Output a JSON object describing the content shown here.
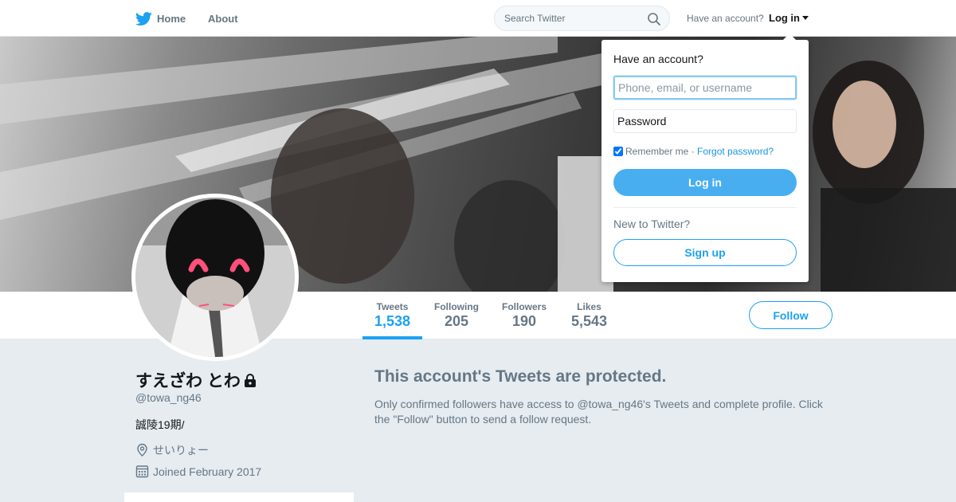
{
  "nav": {
    "home": "Home",
    "about": "About",
    "search_placeholder": "Search Twitter",
    "have_account": "Have an account?",
    "login": "Log in"
  },
  "profile": {
    "name": "すえざわ とわ",
    "handle": "@towa_ng46",
    "bio": "誠陵19期/",
    "location": "せいりょー",
    "joined": "Joined February 2017"
  },
  "stats": [
    {
      "label": "Tweets",
      "value": "1,538"
    },
    {
      "label": "Following",
      "value": "205"
    },
    {
      "label": "Followers",
      "value": "190"
    },
    {
      "label": "Likes",
      "value": "5,543"
    }
  ],
  "follow_button": "Follow",
  "protected": {
    "title": "This account's Tweets are protected.",
    "text": "Only confirmed followers have access to @towa_ng46's Tweets and complete profile. Click the \"Follow\" button to send a follow request."
  },
  "login_dropdown": {
    "heading": "Have an account?",
    "username_placeholder": "Phone, email, or username",
    "password_placeholder": "Password",
    "remember": "Remember me",
    "separator": " · ",
    "forgot": "Forgot password?",
    "login_button": "Log in",
    "new_to": "New to Twitter?",
    "signup_button": "Sign up"
  },
  "colors": {
    "accent": "#1da1f2",
    "background": "#e6ecf0",
    "muted_text": "#657786"
  },
  "icons": [
    "twitter-bird-icon",
    "search-icon",
    "caret-down-icon",
    "lock-icon",
    "location-pin-icon",
    "calendar-icon"
  ]
}
